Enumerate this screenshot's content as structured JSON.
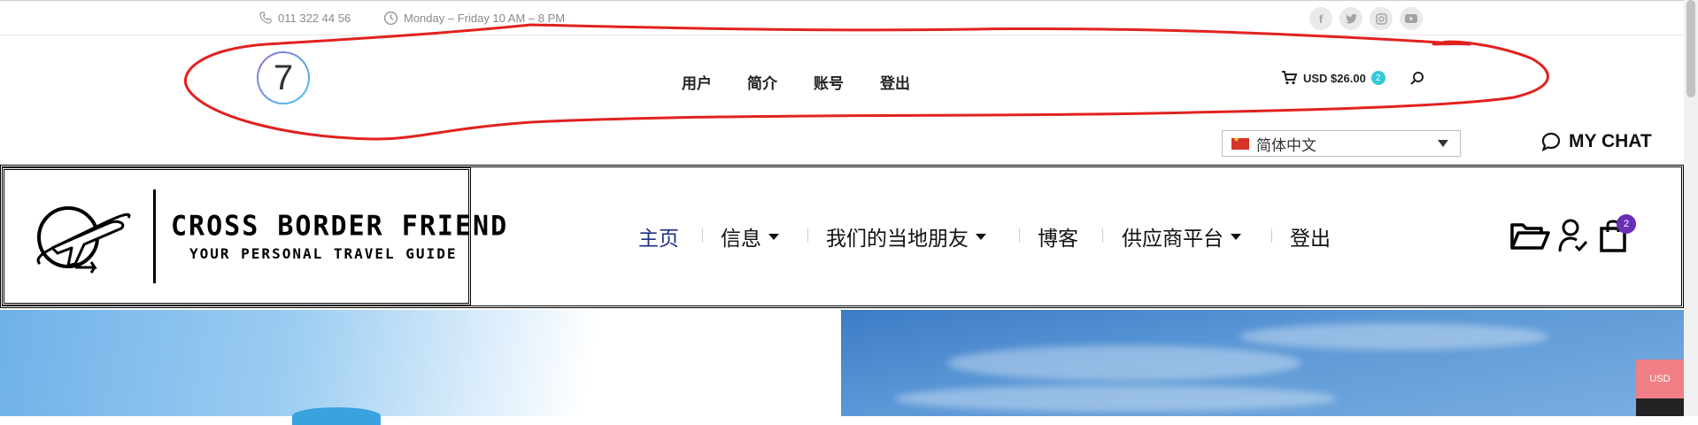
{
  "topbar": {
    "phone": "011 322 44 56",
    "hours": "Monday – Friday 10 AM – 8 PM",
    "social_icons": [
      "facebook-icon",
      "twitter-icon",
      "instagram-icon",
      "youtube-icon"
    ]
  },
  "header1": {
    "logo_text": "7",
    "nav": [
      "用户",
      "简介",
      "账号",
      "登出"
    ],
    "cart_label": "USD $26.00",
    "cart_count": "2"
  },
  "language": {
    "selected": "简体中文"
  },
  "chat": {
    "label": "MY CHAT"
  },
  "brand": {
    "title": "CROSS BORDER FRIEND",
    "subtitle": "YOUR PERSONAL TRAVEL GUIDE"
  },
  "mainnav": {
    "items": [
      "主页",
      "信息",
      "我们的当地朋友",
      "博客",
      "供应商平台",
      "登出"
    ],
    "active_color": "#1e2e8a",
    "cart_count": "2"
  },
  "currency_tab": {
    "label": "USD"
  },
  "colors": {
    "annotation": "#e0221f",
    "badge_teal": "#34c8d8",
    "badge_purple": "#6a2fb5",
    "tab_pink": "#f07f85"
  }
}
